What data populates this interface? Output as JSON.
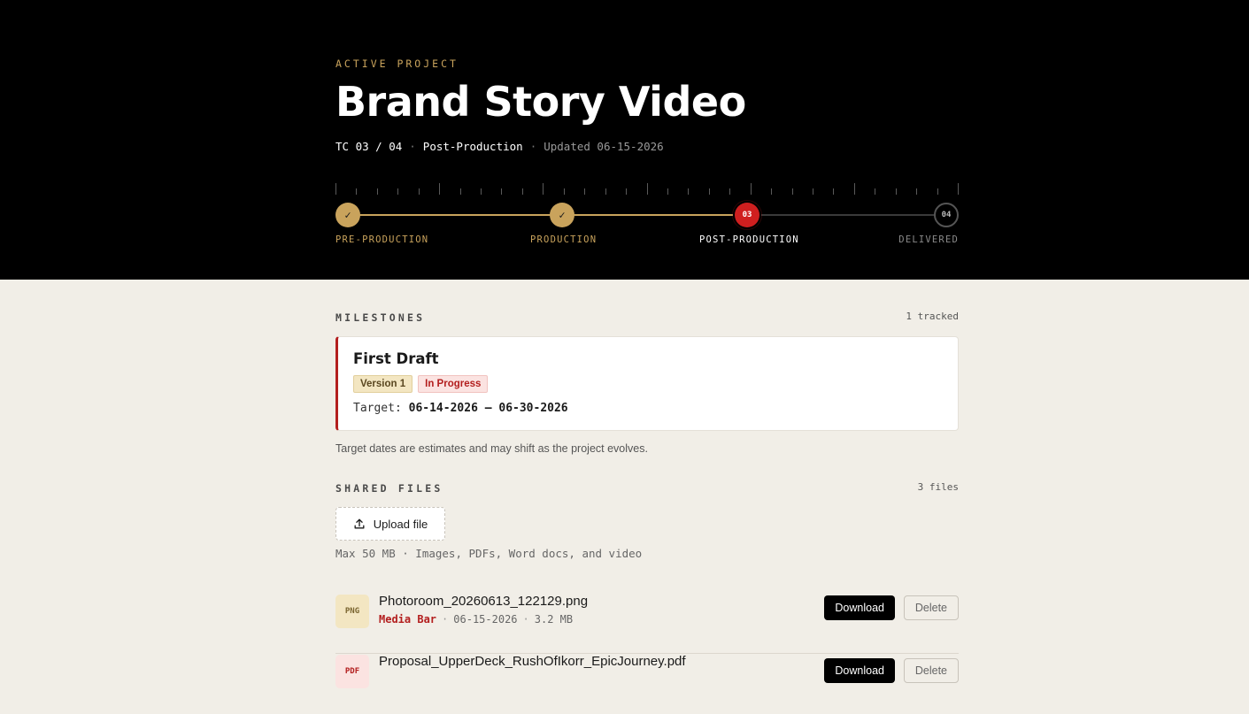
{
  "hero": {
    "eyebrow": "ACTIVE PROJECT",
    "title": "Brand Story Video",
    "timecode": "TC 03 / 04",
    "phase": "Post-Production",
    "updated": "Updated 06-15-2026"
  },
  "stages": [
    {
      "label": "PRE-PRODUCTION",
      "status": "done",
      "marker": "✓"
    },
    {
      "label": "PRODUCTION",
      "status": "done",
      "marker": "✓"
    },
    {
      "label": "POST-PRODUCTION",
      "status": "current",
      "marker": "03"
    },
    {
      "label": "DELIVERED",
      "status": "pending",
      "marker": "04"
    }
  ],
  "milestones": {
    "heading": "MILESTONES",
    "count": "1 tracked",
    "card": {
      "title": "First Draft",
      "version_badge": "Version 1",
      "status_badge": "In Progress",
      "target_label": "Target:",
      "target_range": "06-14-2026 – 06-30-2026"
    },
    "note": "Target dates are estimates and may shift as the project evolves."
  },
  "files": {
    "heading": "SHARED FILES",
    "count": "3 files",
    "upload_label": "Upload file",
    "limits": "Max 50 MB · Images, PDFs, Word docs, and video",
    "download_label": "Download",
    "delete_label": "Delete",
    "items": [
      {
        "type": "PNG",
        "name": "Photoroom_20260613_122129.png",
        "owner": "Media Bar",
        "date": "06-15-2026",
        "size": "3.2 MB"
      },
      {
        "type": "PDF",
        "name": "Proposal_UpperDeck_RushOfIkorr_EpicJourney.pdf",
        "owner": "",
        "date": "",
        "size": ""
      }
    ]
  },
  "colors": {
    "gold": "#c9a35c",
    "red": "#d01f1f",
    "background": "#f1eee7",
    "hero": "#000000"
  }
}
